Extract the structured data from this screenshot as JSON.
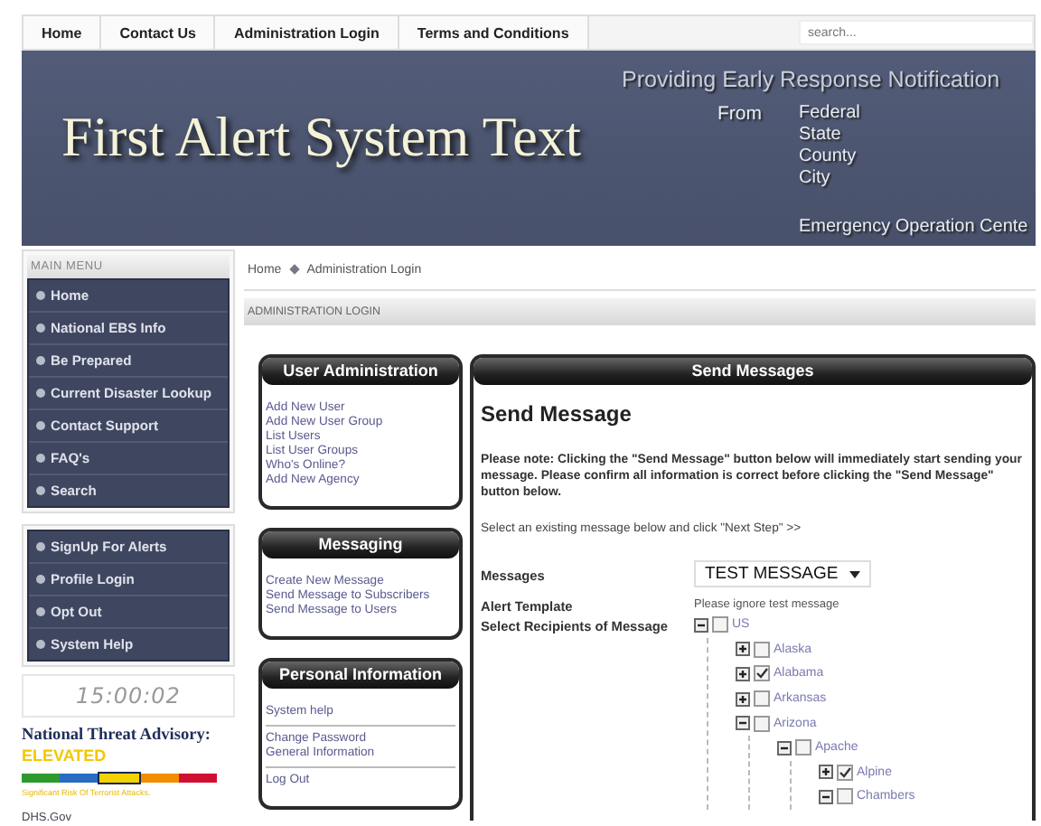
{
  "top_nav": {
    "links": [
      "Home",
      "Contact Us",
      "Administration Login",
      "Terms and Conditions"
    ],
    "search": {
      "placeholder": "search..."
    }
  },
  "banner": {
    "title": "First Alert System Text",
    "tagline": "Providing Early Response Notification",
    "from_label": "From",
    "levels": [
      "Federal",
      "State",
      "County",
      "City"
    ],
    "footer": "Emergency Operation Cente"
  },
  "main_menu": {
    "heading": "MAIN MENU",
    "items": [
      "Home",
      "National EBS Info",
      "Be Prepared",
      "Current Disaster Lookup",
      "Contact Support",
      "FAQ's",
      "Search"
    ]
  },
  "secondary_menu": {
    "items": [
      "SignUp For Alerts",
      "Profile Login",
      "Opt Out",
      "System Help"
    ]
  },
  "clock": "15:00:02",
  "threat_advisory": {
    "title": "National Threat Advisory:",
    "level": "ELEVATED",
    "bands": [
      {
        "color": "#2e9a2e",
        "selected": false
      },
      {
        "color": "#2a6cc0",
        "selected": false
      },
      {
        "color": "#f2d200",
        "selected": true
      },
      {
        "color": "#f28c00",
        "selected": false
      },
      {
        "color": "#d01030",
        "selected": false
      }
    ],
    "note": "Significant Risk Of Terrorist Attacks.",
    "source": "DHS.Gov"
  },
  "breadcrumb": [
    "Home",
    "Administration Login"
  ],
  "page_heading": "ADMINISTRATION LOGIN",
  "side_panels": [
    {
      "title": "User Administration",
      "groups": [
        [
          "Add New User",
          "Add New User Group",
          "List Users",
          "List User Groups",
          "Who's Online?",
          "Add New Agency"
        ]
      ]
    },
    {
      "title": "Messaging",
      "groups": [
        [
          "Create New Message",
          "Send Message to Subscribers",
          "Send Message to Users"
        ]
      ]
    },
    {
      "title": "Personal Information",
      "groups": [
        [
          "System help"
        ],
        [
          "Change Password",
          "General Information"
        ],
        [
          "Log Out"
        ]
      ]
    }
  ],
  "send_panel": {
    "title": "Send Messages",
    "heading": "Send Message",
    "note": "Please note: Clicking the \"Send Message\" button below will immediately start sending your message. Please confirm all information is correct before clicking the \"Send Message\" button below.",
    "instruction": "Select an existing message below and click \"Next Step\" >>",
    "messages": {
      "label": "Messages",
      "value": "TEST MESSAGE"
    },
    "alert_template": {
      "label": "Alert Template",
      "value": "Please ignore test message"
    },
    "recipients": {
      "label": "Select Recipients of Message",
      "tree": [
        {
          "label": "US",
          "expanded": true,
          "checked": false,
          "children": [
            {
              "label": "Alaska",
              "expanded": false,
              "checked": false
            },
            {
              "label": "Alabama",
              "expanded": false,
              "checked": true
            },
            {
              "label": "Arkansas",
              "expanded": false,
              "checked": false
            },
            {
              "label": "Arizona",
              "expanded": true,
              "checked": false,
              "children": [
                {
                  "label": "Apache",
                  "expanded": true,
                  "checked": false,
                  "children": [
                    {
                      "label": "Alpine",
                      "expanded": false,
                      "checked": true
                    },
                    {
                      "label": "Chambers",
                      "expanded": true,
                      "checked": false
                    }
                  ]
                }
              ]
            }
          ]
        }
      ]
    }
  }
}
